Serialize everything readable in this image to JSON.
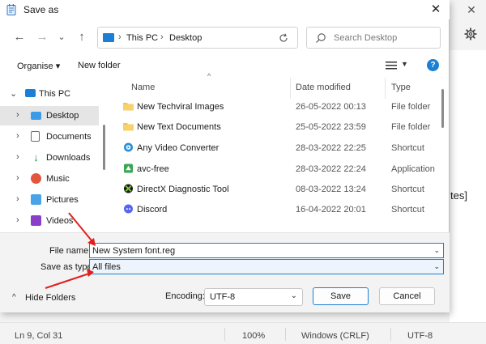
{
  "background": {
    "side_text": "tes]",
    "status": {
      "position": "Ln 9, Col 31",
      "zoom": "100%",
      "line_endings": "Windows (CRLF)",
      "encoding": "UTF-8"
    }
  },
  "dialog": {
    "title": "Save as",
    "address": {
      "root": "This PC",
      "folder": "Desktop"
    },
    "search_placeholder": "Search Desktop",
    "toolbar": {
      "organise": "Organise ▾",
      "new_folder": "New folder"
    },
    "nav_items": [
      {
        "label": "This PC",
        "icon": "pc-icon"
      },
      {
        "label": "Desktop",
        "icon": "desktop-icon"
      },
      {
        "label": "Documents",
        "icon": "documents-icon"
      },
      {
        "label": "Downloads",
        "icon": "downloads-icon"
      },
      {
        "label": "Music",
        "icon": "music-icon"
      },
      {
        "label": "Pictures",
        "icon": "pictures-icon"
      },
      {
        "label": "Videos",
        "icon": "videos-icon"
      }
    ],
    "columns": {
      "name": "Name",
      "date": "Date modified",
      "type": "Type"
    },
    "files": [
      {
        "name": "New Techviral Images",
        "date": "26-05-2022 00:13",
        "type": "File folder",
        "icon": "folder-icon"
      },
      {
        "name": "New Text Documents",
        "date": "25-05-2022 23:59",
        "type": "File folder",
        "icon": "folder-icon"
      },
      {
        "name": "Any Video Converter",
        "date": "28-03-2022 22:25",
        "type": "Shortcut",
        "icon": "video-converter-icon"
      },
      {
        "name": "avc-free",
        "date": "28-03-2022 22:24",
        "type": "Application",
        "icon": "application-icon"
      },
      {
        "name": "DirectX Diagnostic Tool",
        "date": "08-03-2022 13:24",
        "type": "Shortcut",
        "icon": "directx-icon"
      },
      {
        "name": "Discord",
        "date": "16-04-2022 20:01",
        "type": "Shortcut",
        "icon": "discord-icon"
      }
    ],
    "form": {
      "file_name_label": "File name:",
      "file_name_value": "New System font.reg",
      "save_type_label": "Save as type:",
      "save_type_value": "All files",
      "hide_folders": "Hide Folders",
      "encoding_label": "Encoding:",
      "encoding_value": "UTF-8",
      "save": "Save",
      "cancel": "Cancel"
    }
  },
  "colors": {
    "accent": "#1c7fd6",
    "arrow": "#e0201b",
    "folder": "#f2c55c"
  }
}
